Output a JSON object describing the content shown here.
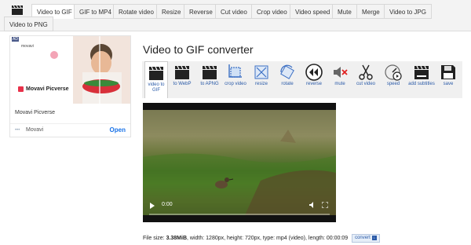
{
  "nav": {
    "tabs": [
      {
        "label": "Video to GIF",
        "active": true
      },
      {
        "label": "GIF to MP4"
      },
      {
        "label": "Rotate video"
      },
      {
        "label": "Resize"
      },
      {
        "label": "Reverse"
      },
      {
        "label": "Cut video"
      },
      {
        "label": "Crop video"
      },
      {
        "label": "Video speed"
      },
      {
        "label": "Mute"
      },
      {
        "label": "Merge"
      },
      {
        "label": "Video to JPG"
      },
      {
        "label": "Video to PNG"
      }
    ]
  },
  "ad": {
    "badge": "AD",
    "small_brand": "movavi",
    "brand_label": "Movavi Picverse",
    "name": "Movavi Picverse",
    "company": "Movavi",
    "open_label": "Open"
  },
  "main": {
    "title": "Video to GIF converter",
    "tools": [
      {
        "label": "video to GIF",
        "icon": "clapperboard-icon"
      },
      {
        "label": "to WebP",
        "icon": "clapperboard-icon"
      },
      {
        "label": "to APNG",
        "icon": "clapperboard-icon"
      },
      {
        "label": "crop video",
        "icon": "crop-icon"
      },
      {
        "label": "resize",
        "icon": "resize-icon"
      },
      {
        "label": "rotate",
        "icon": "rotate-icon"
      },
      {
        "label": "reverse",
        "icon": "rewind-icon"
      },
      {
        "label": "mute",
        "icon": "mute-icon"
      },
      {
        "label": "cut video",
        "icon": "scissors-icon"
      },
      {
        "label": "speed",
        "icon": "speed-icon"
      },
      {
        "label": "add subtitles",
        "icon": "subtitles-icon"
      },
      {
        "label": "save",
        "icon": "save-icon"
      }
    ],
    "video": {
      "time": "0:00"
    },
    "file_info": {
      "prefix": "File size: ",
      "size": "3.38MiB",
      "rest": ", width: 1280px, height: 720px, type: mp4 (video), length: 00:00:09",
      "convert_label": "convert"
    }
  },
  "colors": {
    "link": "#2a5aa8",
    "ad_open": "#1a73e8",
    "movavi_red": "#e8314a"
  }
}
